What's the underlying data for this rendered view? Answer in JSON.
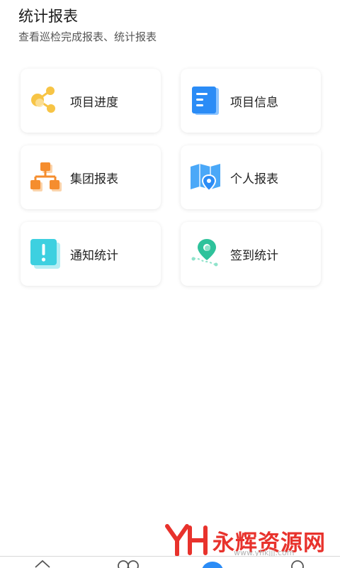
{
  "header": {
    "title": "统计报表",
    "subtitle": "查看巡检完成报表、统计报表"
  },
  "cards": [
    {
      "label": "项目进度",
      "icon": "share-nodes-icon"
    },
    {
      "label": "项目信息",
      "icon": "document-icon"
    },
    {
      "label": "集团报表",
      "icon": "org-chart-icon"
    },
    {
      "label": "个人报表",
      "icon": "map-pin-icon"
    },
    {
      "label": "通知统计",
      "icon": "exclamation-icon"
    },
    {
      "label": "签到统计",
      "icon": "location-checkin-icon"
    }
  ],
  "watermark": {
    "logo_text": "永辉资源网",
    "url": "www.yhkjjj.com"
  },
  "tabbar": {
    "items": [
      "home-icon",
      "people-icon",
      "stats-icon",
      "profile-icon"
    ]
  },
  "colors": {
    "accent_blue": "#2b8cf6",
    "orange": "#f58d2e",
    "yellow": "#f7c445",
    "cyan": "#3dd0e0",
    "green": "#2ec29b",
    "watermark_red": "#e8322c"
  }
}
